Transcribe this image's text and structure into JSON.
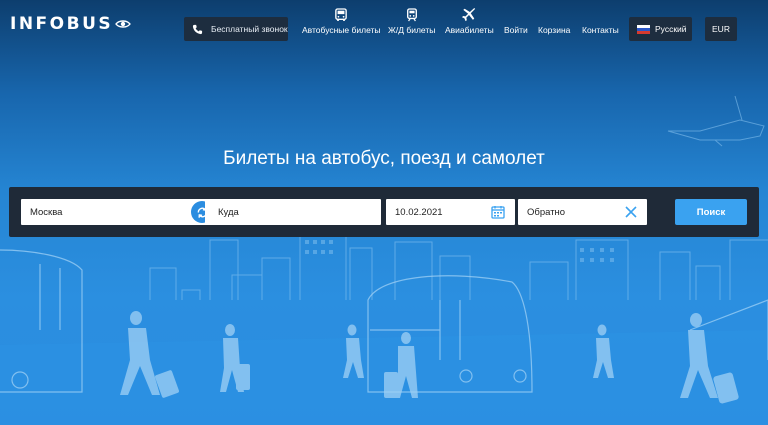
{
  "header": {
    "logo_text": "INFOBUS",
    "call_button": "Бесплатный звонок",
    "nav": [
      {
        "label": "Автобусные билеты",
        "icon": "bus-icon"
      },
      {
        "label": "Ж/Д билеты",
        "icon": "train-icon"
      },
      {
        "label": "Авиабилеты",
        "icon": "plane-icon"
      },
      {
        "label": "Войти"
      },
      {
        "label": "Корзина"
      },
      {
        "label": "Контакты"
      }
    ],
    "language": "Русский",
    "currency": "EUR"
  },
  "hero": {
    "headline": "Билеты на автобус, поезд и самолет"
  },
  "search": {
    "from_value": "Москва",
    "to_placeholder": "Куда",
    "date_value": "10.02.2021",
    "return_placeholder": "Обратно",
    "submit_label": "Поиск"
  },
  "colors": {
    "accent": "#3aa2f0",
    "panel": "#1f2a38",
    "header_button": "#1d2d3f"
  }
}
